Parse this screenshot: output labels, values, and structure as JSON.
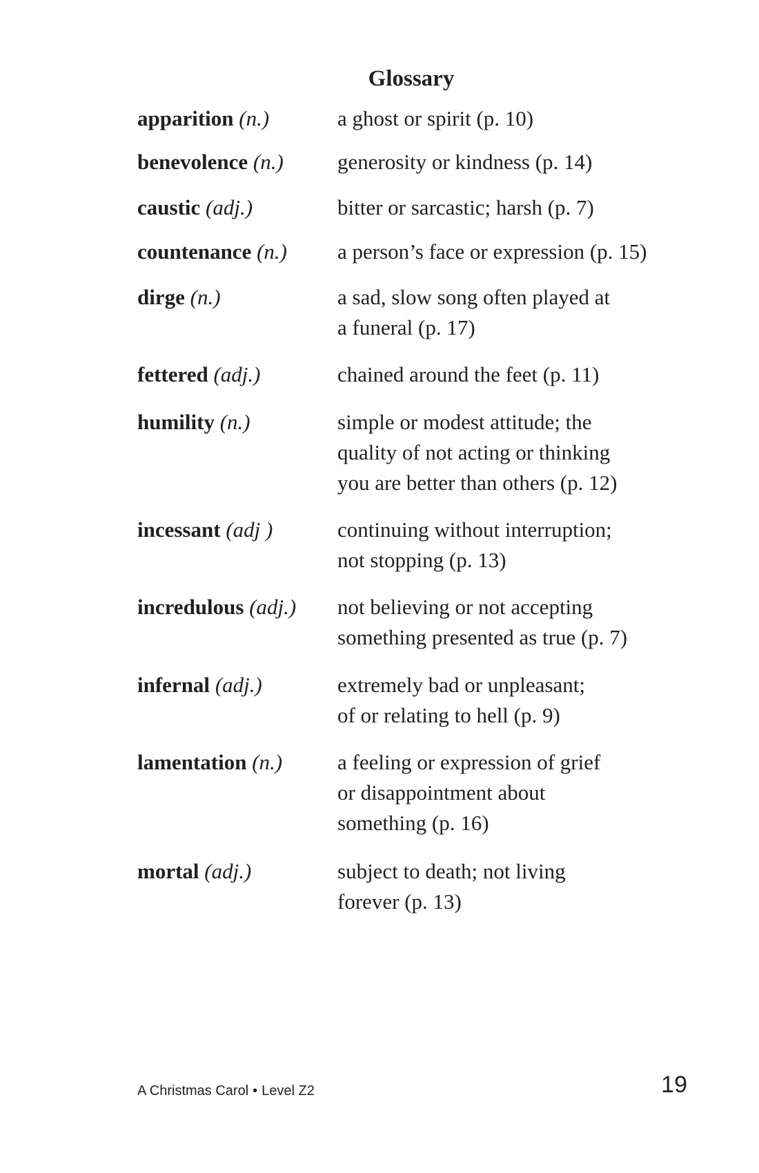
{
  "title": "Glossary",
  "entries": [
    {
      "term": "apparition",
      "pos": "(n.)",
      "definition": "a ghost or spirit (p. 10)"
    },
    {
      "term": "benevolence",
      "pos": "(n.)",
      "definition": "generosity or kindness (p. 14)"
    },
    {
      "term": "caustic",
      "pos": "(adj.)",
      "definition": "bitter or sarcastic; harsh (p. 7)"
    },
    {
      "term": "countenance",
      "pos": "(n.)",
      "definition": "a person’s face or expression (p. 15)"
    },
    {
      "term": "dirge",
      "pos": "(n.)",
      "definition": "a sad, slow song often played at\na funeral (p. 17)"
    },
    {
      "term": "fettered",
      "pos": "(adj.)",
      "definition": "chained around the feet (p. 11)"
    },
    {
      "term": "humility",
      "pos": "(n.)",
      "definition": "simple or modest attitude; the\nquality of not acting or thinking\nyou are better than others (p. 12)"
    },
    {
      "term": "incessant",
      "pos": "(adj )",
      "definition": "continuing without interruption;\nnot stopping (p. 13)"
    },
    {
      "term": "incredulous",
      "pos": "(adj.)",
      "definition": "not believing or not accepting\nsomething presented as true (p. 7)"
    },
    {
      "term": "infernal",
      "pos": "(adj.)",
      "definition": "extremely bad or unpleasant;\nof or relating to hell (p. 9)"
    },
    {
      "term": "lamentation",
      "pos": "(n.)",
      "definition": "a feeling or expression of grief\nor disappointment about\nsomething (p. 16)"
    },
    {
      "term": "mortal",
      "pos": "(adj.)",
      "definition": "subject to death; not living\nforever (p. 13)"
    }
  ],
  "footer": {
    "book_title": "A Christmas Carol",
    "separator": "•",
    "level": "Level Z2",
    "page_number": "19"
  }
}
